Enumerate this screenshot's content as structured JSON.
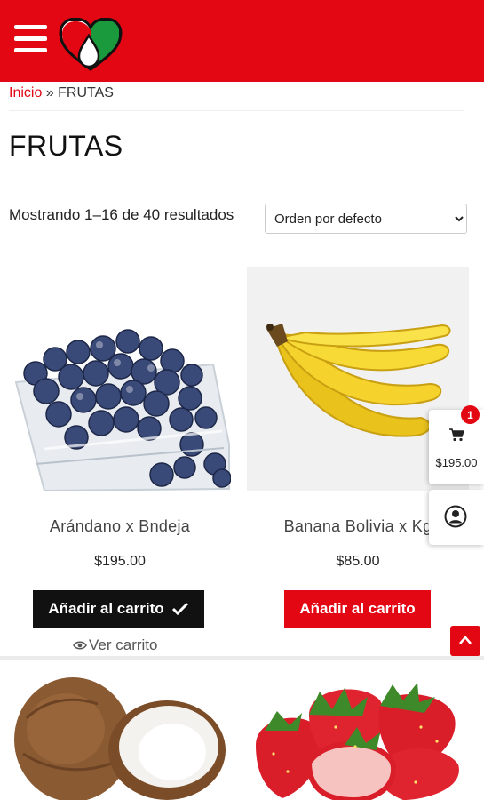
{
  "header": {
    "menu_icon": "hamburger-icon",
    "logo_icon": "heart-drop-logo"
  },
  "breadcrumb": {
    "home": "Inicio",
    "separator": " » ",
    "current": "FRUTAS"
  },
  "page": {
    "title": "FRUTAS"
  },
  "shop": {
    "result_count": "Mostrando 1–16 de 40 resultados",
    "orderby_selected": "Orden por defecto"
  },
  "products": [
    {
      "name": "Arándano x Bndeja",
      "price": "$195.00",
      "button": "Añadir al carrito",
      "added": true,
      "view_cart": "Ver carrito"
    },
    {
      "name": "Banana Bolivia x Kg",
      "price": "$85.00",
      "button": "Añadir al carrito",
      "added": false
    }
  ],
  "floating": {
    "cart_count": "1",
    "cart_total": "$195.00"
  },
  "colors": {
    "brand": "#e30613",
    "added_button": "#111111",
    "logo_green": "#1a9a3c"
  }
}
